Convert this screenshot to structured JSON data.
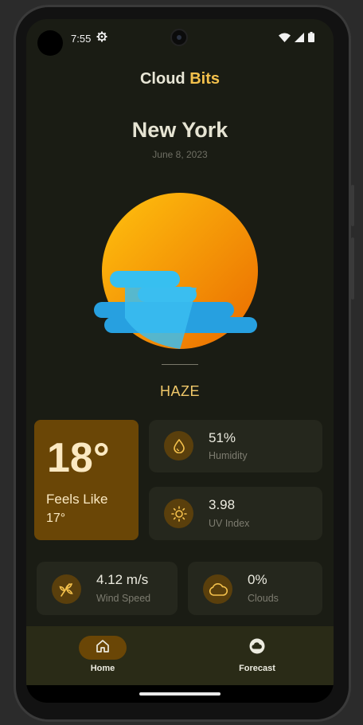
{
  "status_bar": {
    "time": "7:55",
    "icons": [
      "settings-gear-icon",
      "wifi-icon",
      "signal-icon",
      "battery-icon"
    ]
  },
  "app": {
    "title_part1": "Cloud",
    "title_part2": "Bits",
    "accent_color": "#f4c14c"
  },
  "location": {
    "city": "New York",
    "date": "June 8, 2023"
  },
  "weather": {
    "condition": "HAZE",
    "icon": "haze-sun-cloud-icon"
  },
  "temperature": {
    "value": "18°",
    "feels_like_label": "Feels Like",
    "feels_like_value": "17°"
  },
  "stats": {
    "humidity": {
      "value": "51%",
      "label": "Humidity",
      "icon": "droplet-icon"
    },
    "uv_index": {
      "value": "3.98",
      "label": "UV Index",
      "icon": "sun-icon"
    },
    "wind": {
      "value": "4.12 m/s",
      "label": "Wind Speed",
      "icon": "wind-icon"
    },
    "clouds": {
      "value": "0%",
      "label": "Clouds",
      "icon": "cloud-icon"
    }
  },
  "nav": {
    "home_label": "Home",
    "forecast_label": "Forecast"
  },
  "colors": {
    "background": "#1a1c14",
    "card": "#25271d",
    "temp_card": "#6a4606",
    "accent": "#f4c14c"
  }
}
